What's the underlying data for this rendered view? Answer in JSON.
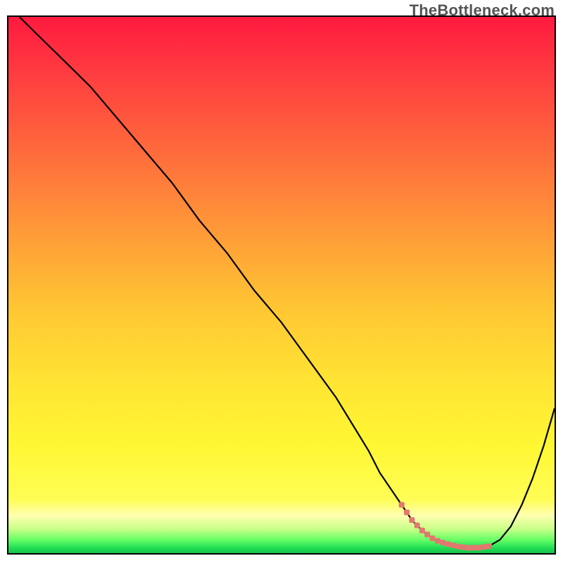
{
  "watermark": "TheBottleneck.com",
  "colors": {
    "border": "#000000",
    "curve": "#000000",
    "highlight": "#e1786f",
    "gradient_stops": [
      {
        "offset": 0.0,
        "color": "#ff1a40"
      },
      {
        "offset": 0.1,
        "color": "#ff3a40"
      },
      {
        "offset": 0.25,
        "color": "#ff6a3c"
      },
      {
        "offset": 0.4,
        "color": "#ff9a38"
      },
      {
        "offset": 0.55,
        "color": "#ffc833"
      },
      {
        "offset": 0.68,
        "color": "#ffe433"
      },
      {
        "offset": 0.8,
        "color": "#fff733"
      },
      {
        "offset": 0.9,
        "color": "#fffd55"
      },
      {
        "offset": 0.93,
        "color": "#ffffb0"
      },
      {
        "offset": 0.955,
        "color": "#c8ff88"
      },
      {
        "offset": 0.975,
        "color": "#66ff66"
      },
      {
        "offset": 0.99,
        "color": "#22dd55"
      },
      {
        "offset": 1.0,
        "color": "#15c24a"
      }
    ]
  },
  "chart_data": {
    "type": "line",
    "title": "",
    "xlabel": "",
    "ylabel": "",
    "xlim": [
      0,
      100
    ],
    "ylim": [
      0,
      100
    ],
    "series": [
      {
        "name": "bottleneck-curve",
        "x": [
          2,
          6,
          10,
          15,
          20,
          25,
          30,
          35,
          40,
          45,
          50,
          55,
          60,
          63,
          66,
          68,
          70,
          72,
          74,
          76,
          78,
          80,
          82,
          84,
          86,
          88,
          90,
          92,
          94,
          96,
          98,
          100
        ],
        "y": [
          100,
          96,
          92,
          87,
          81,
          75,
          69,
          62,
          56,
          49,
          43,
          36,
          29,
          24,
          19,
          15,
          12,
          9,
          6,
          4,
          2.5,
          1.8,
          1.3,
          1.0,
          1.0,
          1.3,
          2.5,
          5,
          9,
          14,
          20,
          27
        ]
      }
    ],
    "highlight_range": {
      "x_start": 72,
      "x_end": 88,
      "y_level": 1.0
    },
    "notes": "Curve descends from top-left, reaches a flat green minimum (highlighted with salmon dotted segment) near x≈72–88, then rises toward the right edge. X/Y values are approximate, read from pixel positions; axes have no printed tick labels."
  }
}
